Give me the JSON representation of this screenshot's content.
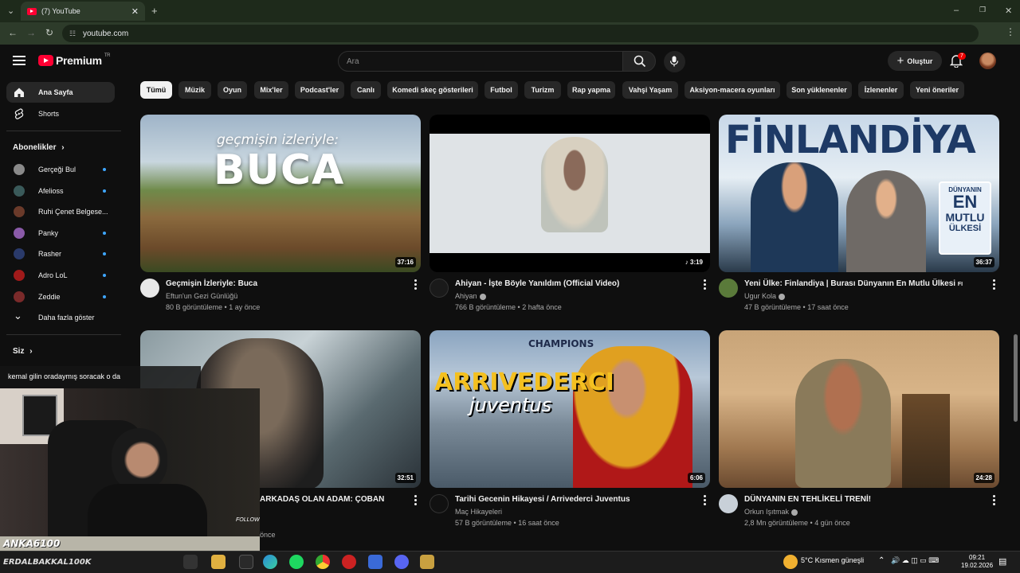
{
  "browser": {
    "tab_title": "(7) YouTube",
    "url": "youtube.com"
  },
  "header": {
    "logo_text": "Premium",
    "logo_sup": "TR",
    "search_placeholder": "Ara",
    "create_label": "Oluştur",
    "notification_count": "7"
  },
  "sidebar": {
    "main": [
      {
        "label": "Ana Sayfa",
        "icon": "home-icon"
      },
      {
        "label": "Shorts",
        "icon": "shorts-icon"
      }
    ],
    "subs_heading": "Abonelikler",
    "subscriptions": [
      {
        "label": "Gerçeği Bul",
        "color": "#8a8a8a"
      },
      {
        "label": "Afelioss",
        "color": "#3a5a5a"
      },
      {
        "label": "Ruhi Çenet Belgese...",
        "color": "#6a3a2a"
      },
      {
        "label": "Panky",
        "color": "#8a5aa8"
      },
      {
        "label": "Rasher",
        "color": "#2a3a6a"
      },
      {
        "label": "Adro LoL",
        "color": "#a01a1a"
      },
      {
        "label": "Zeddie",
        "color": "#7a2a2a"
      }
    ],
    "show_more": "Daha fazla göster",
    "you_heading": "Siz"
  },
  "chips": [
    "Tümü",
    "Müzik",
    "Oyun",
    "Mix'ler",
    "Podcast'ler",
    "Canlı",
    "Komedi skeç gösterileri",
    "Futbol",
    "Turizm",
    "Rap yapma",
    "Vahşi Yaşam",
    "Aksiyon-macera oyunları",
    "Son yüklenenler",
    "İzlenenler",
    "Yeni öneriler"
  ],
  "videos": [
    {
      "title": "Geçmişin İzleriyle: Buca",
      "channel": "Eftun'un Gezi Günlüğü",
      "meta": "80 B görüntüleme • 1 ay önce",
      "duration": "37:16",
      "thumb_text_small": "geçmişin izleriyle:",
      "thumb_text_big": "BUCA"
    },
    {
      "title": "Ahiyan - İşte Böyle Yanıldım (Official Video)",
      "channel": "Ahiyan",
      "meta": "766 B görüntüleme • 2 hafta önce",
      "duration": "♪ 3:19"
    },
    {
      "title": "Yeni Ülke: Finlandiya | Burası Dünyanın En Mutlu Ülkesi",
      "title_flag": "FI",
      "channel": "Ugur Kola",
      "meta": "47 B görüntüleme • 17 saat önce",
      "duration": "36:37",
      "thumb_text_big": "FİNLANDİYA",
      "badge_lines": [
        "DÜNYANIN",
        "EN",
        "MUTLU",
        "ÜLKESİ"
      ]
    },
    {
      "title": "ARKADAŞ OLAN ADAM: ÇOBAN",
      "meta": "önce",
      "duration": "32:51"
    },
    {
      "title": "Tarihi Gecenin Hikayesi / Arrivederci Juventus",
      "channel": "Maç Hikayeleri",
      "meta": "57 B görüntüleme • 16 saat önce",
      "duration": "6:06",
      "thumb_text_big": "ARRIVEDERCI",
      "thumb_text_small": "juventus",
      "thumb_text_top": "CHAMPIONS"
    },
    {
      "title": "DÜNYANIN EN TEHLİKELİ TRENİ!",
      "channel": "Orkun Işıtmak",
      "meta": "2,8 Mn görüntüleme • 4 gün önce",
      "duration": "24:28"
    }
  ],
  "overlay": {
    "chat_message": "kemal gilin oradaymış soracak o da",
    "nickname": "ANKA6100",
    "nickname2": "ERDALBAKKAL100K",
    "follow": "FOLLOW"
  },
  "taskbar": {
    "weather": "5°C  Kısmen güneşli",
    "time": "09:21",
    "date": "19.02.2026"
  }
}
